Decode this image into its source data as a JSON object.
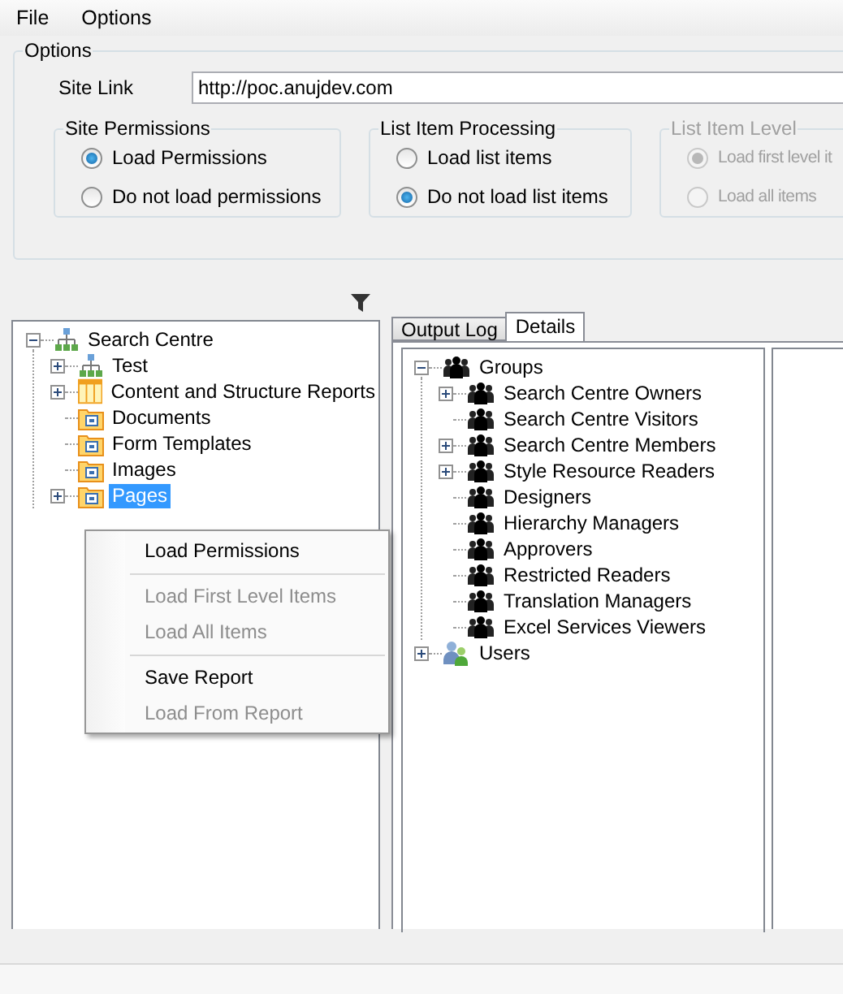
{
  "menu": [
    "File",
    "Options"
  ],
  "options": {
    "title": "Options",
    "site_link": {
      "label": "Site Link",
      "value": "http://poc.anujdev.com"
    },
    "groups": [
      {
        "title": "Site Permissions",
        "disabled": false,
        "radios": [
          {
            "label": "Load Permissions",
            "selected": true
          },
          {
            "label": "Do not load permissions",
            "selected": false
          }
        ]
      },
      {
        "title": "List Item Processing",
        "disabled": false,
        "radios": [
          {
            "label": "Load list items",
            "selected": false
          },
          {
            "label": "Do not load list items",
            "selected": true
          }
        ]
      },
      {
        "title": "List Item Level",
        "disabled": true,
        "radios": [
          {
            "label": "Load first level it",
            "selected": true
          },
          {
            "label": "Load all items",
            "selected": false
          }
        ]
      }
    ]
  },
  "site_tree": [
    {
      "label": "Search Centre",
      "kind": "site",
      "expanded": true,
      "selected": false,
      "children": [
        {
          "label": "Test",
          "kind": "site",
          "expanded": false,
          "selected": false
        },
        {
          "label": "Content and Structure Reports",
          "kind": "list",
          "expanded": false,
          "selected": false
        },
        {
          "label": "Documents",
          "kind": "library",
          "selected": false
        },
        {
          "label": "Form Templates",
          "kind": "library",
          "selected": false
        },
        {
          "label": "Images",
          "kind": "library",
          "selected": false
        },
        {
          "label": "Pages",
          "kind": "library",
          "expanded": false,
          "selected": true
        }
      ]
    }
  ],
  "tabs": [
    {
      "label": "Output Log",
      "selected": false
    },
    {
      "label": "Details",
      "selected": true
    }
  ],
  "details_tree": [
    {
      "label": "Groups",
      "kind": "group",
      "expanded": true,
      "selected": false,
      "children": [
        {
          "label": "Search Centre Owners",
          "kind": "group",
          "expanded": false,
          "selected": false
        },
        {
          "label": "Search Centre Visitors",
          "kind": "group",
          "selected": false
        },
        {
          "label": "Search Centre Members",
          "kind": "group",
          "expanded": false,
          "selected": false
        },
        {
          "label": "Style Resource Readers",
          "kind": "group",
          "expanded": false,
          "selected": false
        },
        {
          "label": "Designers",
          "kind": "group",
          "selected": false
        },
        {
          "label": "Hierarchy Managers",
          "kind": "group",
          "selected": false
        },
        {
          "label": "Approvers",
          "kind": "group",
          "selected": false
        },
        {
          "label": "Restricted Readers",
          "kind": "group",
          "selected": false
        },
        {
          "label": "Translation Managers",
          "kind": "group",
          "selected": false
        },
        {
          "label": "Excel Services Viewers",
          "kind": "group",
          "selected": false
        }
      ]
    },
    {
      "label": "Users",
      "kind": "users",
      "expanded": false,
      "selected": false
    }
  ],
  "context_menu": [
    {
      "kind": "item",
      "label": "Load Permissions",
      "disabled": false
    },
    {
      "kind": "separator"
    },
    {
      "kind": "item",
      "label": "Load First Level Items",
      "disabled": true
    },
    {
      "kind": "item",
      "label": "Load All Items",
      "disabled": true
    },
    {
      "kind": "separator"
    },
    {
      "kind": "item",
      "label": "Save Report",
      "disabled": false
    },
    {
      "kind": "item",
      "label": "Load From Report",
      "disabled": true
    }
  ]
}
